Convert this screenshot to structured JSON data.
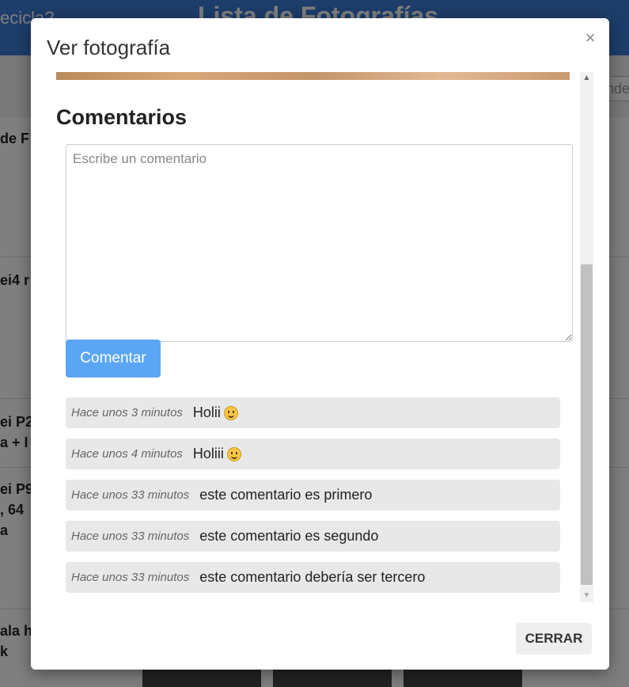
{
  "background": {
    "header_left_text": "ecicla?",
    "header_title": "Lista de Fotografías",
    "search_partial": "nde",
    "rows": [
      {
        "text": "de F"
      },
      {
        "text": "ei4 r"
      },
      {
        "text": "ei P2\na + I"
      },
      {
        "text": "ei P9\n, 64\na"
      },
      {
        "text": "ala h\nk"
      }
    ]
  },
  "modal": {
    "title": "Ver fotografía",
    "close_icon": "×",
    "comments_heading": "Comentarios",
    "textarea_placeholder": "Escribe un comentario",
    "textarea_value": "",
    "comment_button_label": "Comentar",
    "comments": [
      {
        "time": "Hace unos 3 minutos",
        "text": "Holii",
        "emoji": true
      },
      {
        "time": "Hace unos 4 minutos",
        "text": "Holiii",
        "emoji": true
      },
      {
        "time": "Hace unos 33 minutos",
        "text": "este comentario es primero",
        "emoji": false
      },
      {
        "time": "Hace unos 33 minutos",
        "text": "este comentario es segundo",
        "emoji": false
      },
      {
        "time": "Hace unos 33 minutos",
        "text": "este comentario debería ser tercero",
        "emoji": false
      }
    ],
    "footer_close_label": "CERRAR",
    "scroll_up_icon": "▲",
    "scroll_down_icon": "▼"
  },
  "colors": {
    "header_bg": "#3a7bd5",
    "comment_button_bg": "#5aa6f5",
    "comment_item_bg": "#e8e8e8",
    "emoji": "#f5c648"
  }
}
